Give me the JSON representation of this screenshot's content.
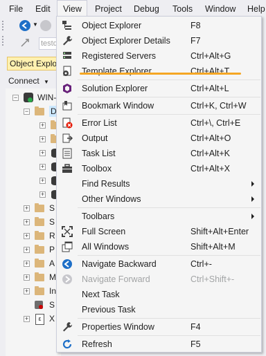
{
  "menubar": {
    "file": "File",
    "edit": "Edit",
    "view": "View",
    "project": "Project",
    "debug": "Debug",
    "tools": "Tools",
    "window": "Window",
    "help": "Help"
  },
  "toolbar": {
    "db_text": "testd"
  },
  "object_explorer": {
    "tab_label": "Object Explorer",
    "connect_label": "Connect",
    "server_label": "WIN-",
    "db_label": "D",
    "folder_letters": [
      "S",
      "S",
      "R",
      "P",
      "A",
      "M",
      "In",
      "S",
      "X"
    ]
  },
  "view_menu": {
    "groups": [
      [
        {
          "icon": "object-explorer-icon",
          "label": "Object Explorer",
          "shortcut": "F8"
        },
        {
          "icon": "wrench-icon",
          "label": "Object Explorer Details",
          "shortcut": "F7"
        },
        {
          "icon": "registered-servers-icon",
          "label": "Registered Servers",
          "shortcut": "Ctrl+Alt+G"
        },
        {
          "icon": "template-explorer-icon",
          "label": "Template Explorer",
          "shortcut": "Ctrl+Alt+T"
        }
      ],
      [
        {
          "icon": "solution-explorer-icon",
          "label": "Solution Explorer",
          "shortcut": "Ctrl+Alt+L"
        }
      ],
      [
        {
          "icon": "bookmark-icon",
          "label": "Bookmark Window",
          "shortcut": "Ctrl+K, Ctrl+W"
        }
      ],
      [
        {
          "icon": "error-list-icon",
          "label": "Error List",
          "shortcut": "Ctrl+\\, Ctrl+E"
        },
        {
          "icon": "output-icon",
          "label": "Output",
          "shortcut": "Ctrl+Alt+O"
        },
        {
          "icon": "task-list-icon",
          "label": "Task List",
          "shortcut": "Ctrl+Alt+K"
        },
        {
          "icon": "toolbox-icon",
          "label": "Toolbox",
          "shortcut": "Ctrl+Alt+X"
        },
        {
          "icon": "",
          "label": "Find Results",
          "shortcut": "",
          "submenu": true
        },
        {
          "icon": "",
          "label": "Other Windows",
          "shortcut": "",
          "submenu": true
        }
      ],
      [
        {
          "icon": "",
          "label": "Toolbars",
          "shortcut": "",
          "submenu": true
        },
        {
          "icon": "full-screen-icon",
          "label": "Full Screen",
          "shortcut": "Shift+Alt+Enter"
        },
        {
          "icon": "all-windows-icon",
          "label": "All Windows",
          "shortcut": "Shift+Alt+M"
        }
      ],
      [
        {
          "icon": "navigate-backward-icon",
          "label": "Navigate Backward",
          "shortcut": "Ctrl+-"
        },
        {
          "icon": "navigate-forward-icon",
          "label": "Navigate Forward",
          "shortcut": "Ctrl+Shift+-",
          "disabled": true
        },
        {
          "icon": "",
          "label": "Next Task",
          "shortcut": ""
        },
        {
          "icon": "",
          "label": "Previous Task",
          "shortcut": ""
        }
      ],
      [
        {
          "icon": "wrench-icon",
          "label": "Properties Window",
          "shortcut": "F4"
        }
      ],
      [
        {
          "icon": "refresh-icon",
          "label": "Refresh",
          "shortcut": "F5"
        }
      ]
    ]
  },
  "colors": {
    "highlight_underline": "#f5a623",
    "accent_blue": "#1e6fc7",
    "tab_yellow": "#fff1b0"
  }
}
